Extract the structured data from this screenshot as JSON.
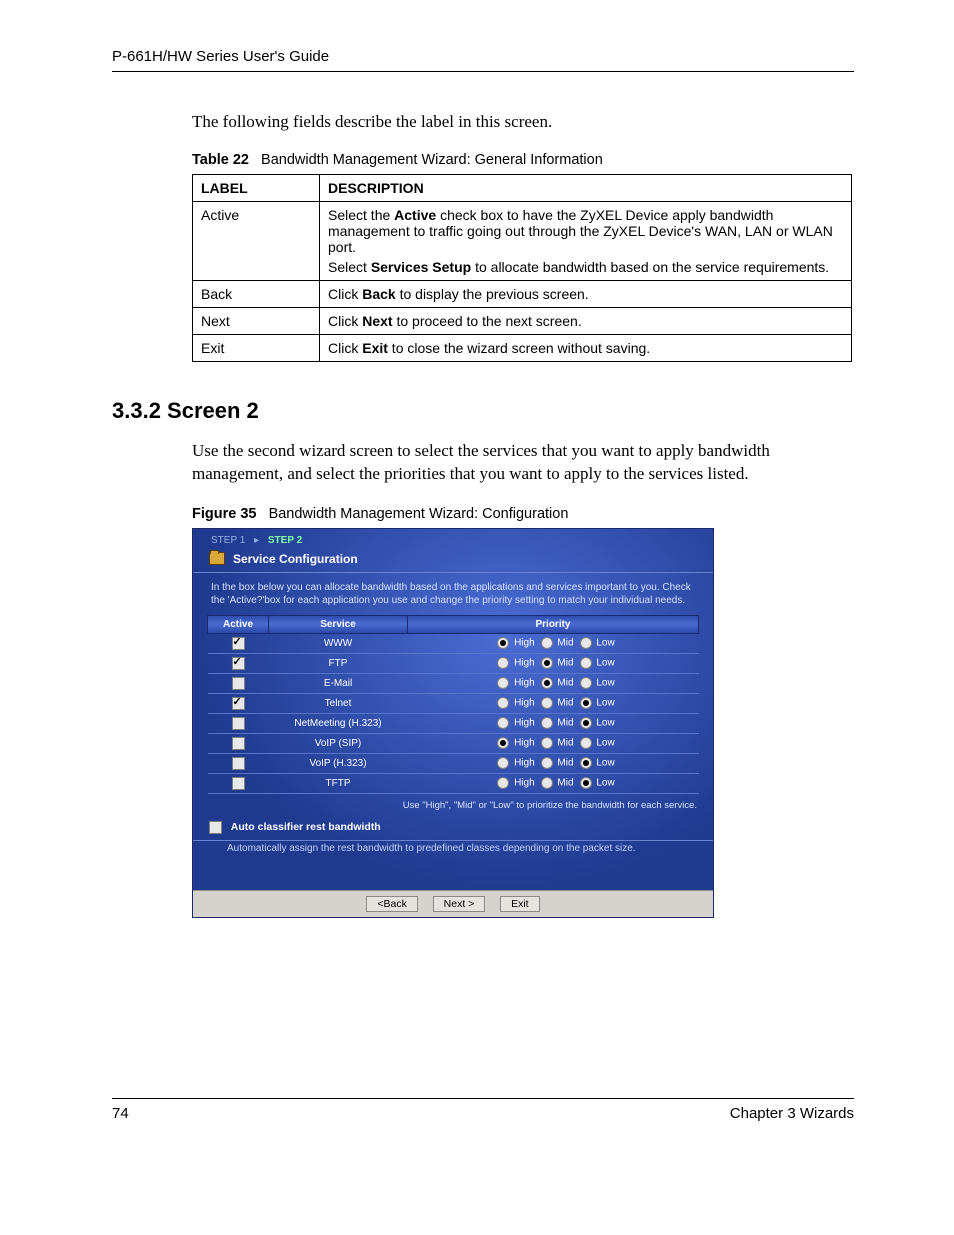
{
  "header": "P-661H/HW Series User's Guide",
  "intro": "The following fields describe the label in this screen.",
  "table_caption_bold": "Table 22",
  "table_caption_rest": "Bandwidth Management Wizard: General Information",
  "table_headers": {
    "label": "LABEL",
    "desc": "DESCRIPTION"
  },
  "table_rows": [
    {
      "label": "Active",
      "desc_pre": "Select the ",
      "desc_bold1": "Active",
      "desc_mid1": " check box to have the ZyXEL Device apply bandwidth management to traffic going out through the ZyXEL Device's WAN, LAN or WLAN port.",
      "desc_line2_pre": "Select ",
      "desc_line2_bold": "Services Setup",
      "desc_line2_rest": " to allocate bandwidth based on the service requirements."
    },
    {
      "label": "Back",
      "desc_pre": "Click ",
      "desc_bold1": "Back",
      "desc_mid1": " to display the previous screen."
    },
    {
      "label": "Next",
      "desc_pre": "Click ",
      "desc_bold1": "Next",
      "desc_mid1": " to proceed to the next screen."
    },
    {
      "label": "Exit",
      "desc_pre": "Click ",
      "desc_bold1": "Exit",
      "desc_mid1": " to close the wizard screen without saving."
    }
  ],
  "section_heading": "3.3.2  Screen 2",
  "section_para": "Use the second wizard screen to select the services that you want to apply bandwidth management, and select the priorities that you want to apply to the services listed.",
  "figure_caption_bold": "Figure 35",
  "figure_caption_rest": "Bandwidth Management Wizard: Configuration",
  "wizard": {
    "step1": "STEP 1",
    "step2": "STEP 2",
    "title": "Service Configuration",
    "description": "In the box below you can allocate bandwidth based on the applications and services important to you. Check the 'Active?'box for each application you use and change the priority setting to match your individual needs.",
    "columns": {
      "active": "Active",
      "service": "Service",
      "priority": "Priority"
    },
    "priority_labels": {
      "high": "High",
      "mid": "Mid",
      "low": "Low"
    },
    "rows": [
      {
        "active": true,
        "service": "WWW",
        "priority": "High"
      },
      {
        "active": true,
        "service": "FTP",
        "priority": "Mid"
      },
      {
        "active": false,
        "service": "E-Mail",
        "priority": "Mid"
      },
      {
        "active": true,
        "service": "Telnet",
        "priority": "Low"
      },
      {
        "active": false,
        "service": "NetMeeting (H.323)",
        "priority": "Low"
      },
      {
        "active": false,
        "service": "VoIP (SIP)",
        "priority": "High"
      },
      {
        "active": false,
        "service": "VoIP (H.323)",
        "priority": "Low"
      },
      {
        "active": false,
        "service": "TFTP",
        "priority": "Low"
      }
    ],
    "hint": "Use \"High\", \"Mid\" or \"Low\" to prioritize the bandwidth for each service.",
    "auto_checked": false,
    "auto_label": "Auto classifier rest bandwidth",
    "auto_desc": "Automatically assign the rest bandwidth to predefined classes depending on the packet size.",
    "buttons": {
      "back": "<Back",
      "next": "Next >",
      "exit": "Exit"
    }
  },
  "footer": {
    "page": "74",
    "chapter": "Chapter 3 Wizards"
  }
}
